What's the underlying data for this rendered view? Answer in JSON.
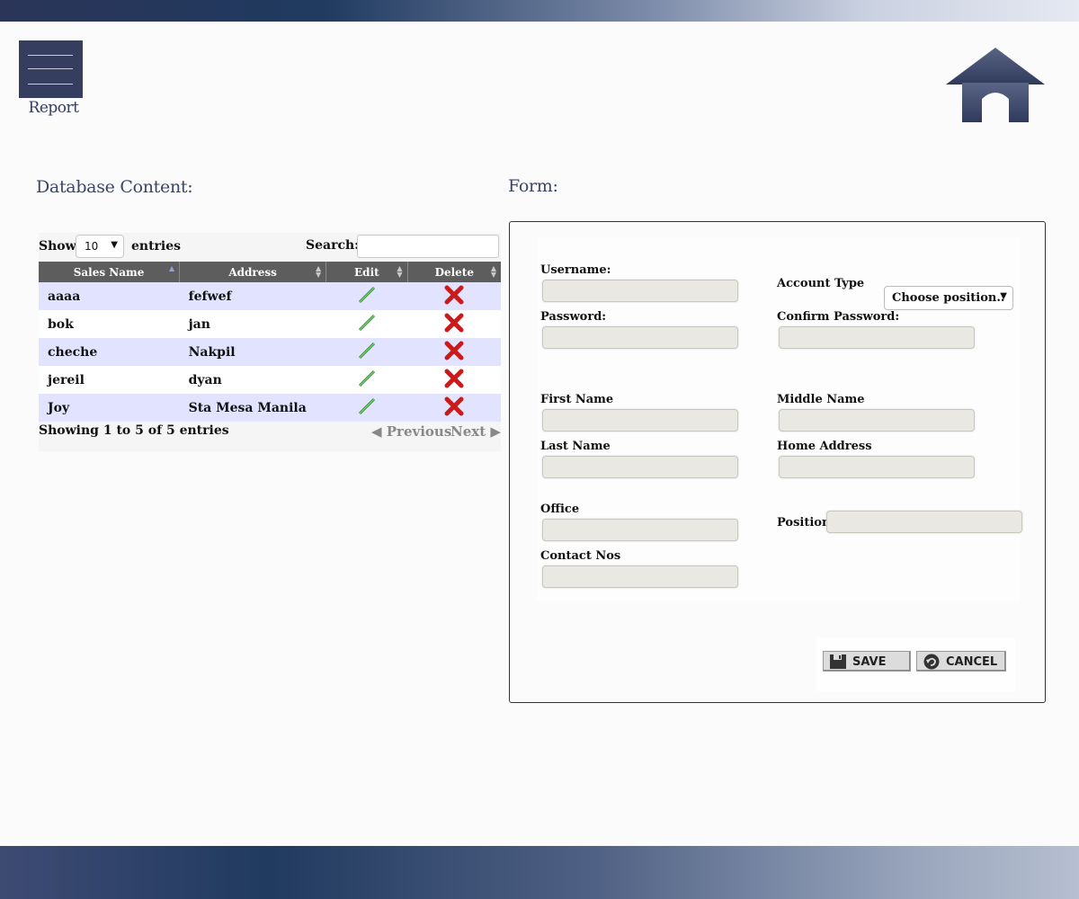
{
  "nav": {
    "menu_label": "Report"
  },
  "sections": {
    "table_title": "Database Content:",
    "form_title": "Form:"
  },
  "table": {
    "show_label": "Show",
    "entries_label": "entries",
    "length_value": "10",
    "search_label": "Search:",
    "search_value": "",
    "columns": [
      "Sales Name",
      "Address",
      "Edit",
      "Delete"
    ],
    "rows": [
      {
        "name": "aaaa",
        "address": "fefwef"
      },
      {
        "name": "bok",
        "address": "jan"
      },
      {
        "name": "cheche",
        "address": "Nakpil"
      },
      {
        "name": "jereil",
        "address": "dyan"
      },
      {
        "name": "Joy",
        "address": "Sta Mesa Manila"
      }
    ],
    "info": "Showing 1 to 5 of 5 entries",
    "prev_label": "Previous",
    "next_label": "Next"
  },
  "form": {
    "username_label": "Username:",
    "account_type_label": "Account Type",
    "account_type_value": "Choose position..",
    "password_label": "Password:",
    "confirm_password_label": "Confirm Password:",
    "first_name_label": "First Name",
    "middle_name_label": "Middle Name",
    "last_name_label": "Last Name",
    "home_address_label": "Home Address",
    "office_label": "Office",
    "position_label": "Position",
    "contact_label": "Contact Nos",
    "save_label": "SAVE",
    "cancel_label": "CANCEL"
  },
  "icons": {
    "edit": "pencil-icon",
    "delete": "red-x-icon",
    "home": "home-icon",
    "menu": "hamburger-icon",
    "save": "floppy-disk-icon",
    "cancel": "undo-arrow-icon"
  },
  "colors": {
    "nav_dark": "#353e5e",
    "table_header": "#5d5d5d",
    "row_odd": "#e2e4ff",
    "delete_red": "#cc1a1a",
    "input_bg": "#e9e8e2"
  }
}
